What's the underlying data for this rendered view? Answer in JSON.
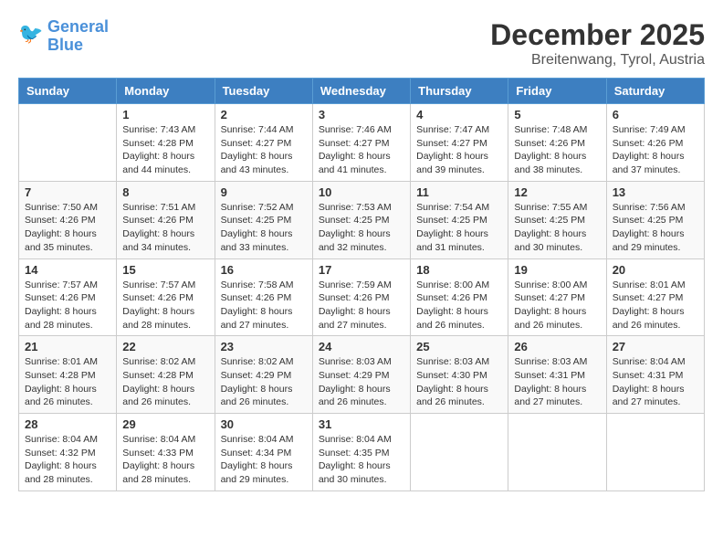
{
  "header": {
    "logo_line1": "General",
    "logo_line2": "Blue",
    "month": "December 2025",
    "location": "Breitenwang, Tyrol, Austria"
  },
  "weekdays": [
    "Sunday",
    "Monday",
    "Tuesday",
    "Wednesday",
    "Thursday",
    "Friday",
    "Saturday"
  ],
  "weeks": [
    [
      {
        "day": "",
        "info": ""
      },
      {
        "day": "1",
        "info": "Sunrise: 7:43 AM\nSunset: 4:28 PM\nDaylight: 8 hours\nand 44 minutes."
      },
      {
        "day": "2",
        "info": "Sunrise: 7:44 AM\nSunset: 4:27 PM\nDaylight: 8 hours\nand 43 minutes."
      },
      {
        "day": "3",
        "info": "Sunrise: 7:46 AM\nSunset: 4:27 PM\nDaylight: 8 hours\nand 41 minutes."
      },
      {
        "day": "4",
        "info": "Sunrise: 7:47 AM\nSunset: 4:27 PM\nDaylight: 8 hours\nand 39 minutes."
      },
      {
        "day": "5",
        "info": "Sunrise: 7:48 AM\nSunset: 4:26 PM\nDaylight: 8 hours\nand 38 minutes."
      },
      {
        "day": "6",
        "info": "Sunrise: 7:49 AM\nSunset: 4:26 PM\nDaylight: 8 hours\nand 37 minutes."
      }
    ],
    [
      {
        "day": "7",
        "info": "Sunrise: 7:50 AM\nSunset: 4:26 PM\nDaylight: 8 hours\nand 35 minutes."
      },
      {
        "day": "8",
        "info": "Sunrise: 7:51 AM\nSunset: 4:26 PM\nDaylight: 8 hours\nand 34 minutes."
      },
      {
        "day": "9",
        "info": "Sunrise: 7:52 AM\nSunset: 4:25 PM\nDaylight: 8 hours\nand 33 minutes."
      },
      {
        "day": "10",
        "info": "Sunrise: 7:53 AM\nSunset: 4:25 PM\nDaylight: 8 hours\nand 32 minutes."
      },
      {
        "day": "11",
        "info": "Sunrise: 7:54 AM\nSunset: 4:25 PM\nDaylight: 8 hours\nand 31 minutes."
      },
      {
        "day": "12",
        "info": "Sunrise: 7:55 AM\nSunset: 4:25 PM\nDaylight: 8 hours\nand 30 minutes."
      },
      {
        "day": "13",
        "info": "Sunrise: 7:56 AM\nSunset: 4:25 PM\nDaylight: 8 hours\nand 29 minutes."
      }
    ],
    [
      {
        "day": "14",
        "info": "Sunrise: 7:57 AM\nSunset: 4:26 PM\nDaylight: 8 hours\nand 28 minutes."
      },
      {
        "day": "15",
        "info": "Sunrise: 7:57 AM\nSunset: 4:26 PM\nDaylight: 8 hours\nand 28 minutes."
      },
      {
        "day": "16",
        "info": "Sunrise: 7:58 AM\nSunset: 4:26 PM\nDaylight: 8 hours\nand 27 minutes."
      },
      {
        "day": "17",
        "info": "Sunrise: 7:59 AM\nSunset: 4:26 PM\nDaylight: 8 hours\nand 27 minutes."
      },
      {
        "day": "18",
        "info": "Sunrise: 8:00 AM\nSunset: 4:26 PM\nDaylight: 8 hours\nand 26 minutes."
      },
      {
        "day": "19",
        "info": "Sunrise: 8:00 AM\nSunset: 4:27 PM\nDaylight: 8 hours\nand 26 minutes."
      },
      {
        "day": "20",
        "info": "Sunrise: 8:01 AM\nSunset: 4:27 PM\nDaylight: 8 hours\nand 26 minutes."
      }
    ],
    [
      {
        "day": "21",
        "info": "Sunrise: 8:01 AM\nSunset: 4:28 PM\nDaylight: 8 hours\nand 26 minutes."
      },
      {
        "day": "22",
        "info": "Sunrise: 8:02 AM\nSunset: 4:28 PM\nDaylight: 8 hours\nand 26 minutes."
      },
      {
        "day": "23",
        "info": "Sunrise: 8:02 AM\nSunset: 4:29 PM\nDaylight: 8 hours\nand 26 minutes."
      },
      {
        "day": "24",
        "info": "Sunrise: 8:03 AM\nSunset: 4:29 PM\nDaylight: 8 hours\nand 26 minutes."
      },
      {
        "day": "25",
        "info": "Sunrise: 8:03 AM\nSunset: 4:30 PM\nDaylight: 8 hours\nand 26 minutes."
      },
      {
        "day": "26",
        "info": "Sunrise: 8:03 AM\nSunset: 4:31 PM\nDaylight: 8 hours\nand 27 minutes."
      },
      {
        "day": "27",
        "info": "Sunrise: 8:04 AM\nSunset: 4:31 PM\nDaylight: 8 hours\nand 27 minutes."
      }
    ],
    [
      {
        "day": "28",
        "info": "Sunrise: 8:04 AM\nSunset: 4:32 PM\nDaylight: 8 hours\nand 28 minutes."
      },
      {
        "day": "29",
        "info": "Sunrise: 8:04 AM\nSunset: 4:33 PM\nDaylight: 8 hours\nand 28 minutes."
      },
      {
        "day": "30",
        "info": "Sunrise: 8:04 AM\nSunset: 4:34 PM\nDaylight: 8 hours\nand 29 minutes."
      },
      {
        "day": "31",
        "info": "Sunrise: 8:04 AM\nSunset: 4:35 PM\nDaylight: 8 hours\nand 30 minutes."
      },
      {
        "day": "",
        "info": ""
      },
      {
        "day": "",
        "info": ""
      },
      {
        "day": "",
        "info": ""
      }
    ]
  ]
}
